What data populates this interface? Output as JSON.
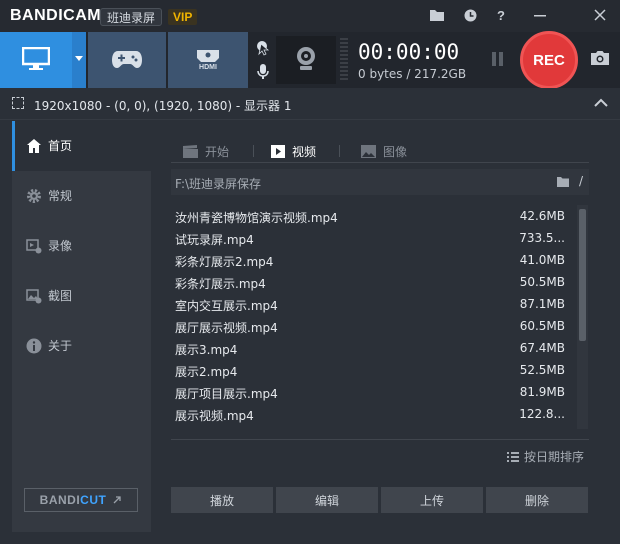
{
  "app": {
    "logo_main": "BANDI",
    "logo_cam": "CAM",
    "tag": "班迪录屏",
    "vip": "VIP"
  },
  "titlebar_icons": [
    "folder-icon",
    "clock-icon",
    "help-icon",
    "minimize-icon",
    "close-icon"
  ],
  "toolbar": {
    "hdmi_label": "HDMI",
    "timer": "00:00:00",
    "size": "0 bytes / 217.2GB",
    "rec_label": "REC"
  },
  "resolution": {
    "text": "1920x1080 - (0, 0), (1920, 1080) - 显示器 1"
  },
  "sidebar": {
    "items": [
      {
        "label": "首页",
        "icon": "home-icon",
        "active": true
      },
      {
        "label": "常规",
        "icon": "gear-icon",
        "active": false
      },
      {
        "label": "录像",
        "icon": "video-settings-icon",
        "active": false
      },
      {
        "label": "截图",
        "icon": "image-settings-icon",
        "active": false
      },
      {
        "label": "关于",
        "icon": "info-icon",
        "active": false
      }
    ],
    "bandicut_a": "BANDI",
    "bandicut_b": "CUT"
  },
  "tabs": [
    {
      "label": "开始",
      "active": false
    },
    {
      "label": "视频",
      "active": true
    },
    {
      "label": "图像",
      "active": false
    }
  ],
  "path": {
    "text": "F:\\班迪录屏保存",
    "root": "/"
  },
  "files": [
    {
      "name": "汝州青瓷博物馆演示视频.mp4",
      "size": "42.6MB"
    },
    {
      "name": "试玩录屏.mp4",
      "size": "733.5..."
    },
    {
      "name": "彩条灯展示2.mp4",
      "size": "41.0MB"
    },
    {
      "name": "彩条灯展示.mp4",
      "size": "50.5MB"
    },
    {
      "name": "室内交互展示.mp4",
      "size": "87.1MB"
    },
    {
      "name": "展厅展示视频.mp4",
      "size": "60.5MB"
    },
    {
      "name": "展示3.mp4",
      "size": "67.4MB"
    },
    {
      "name": "展示2.mp4",
      "size": "52.5MB"
    },
    {
      "name": "展厅项目展示.mp4",
      "size": "81.9MB"
    },
    {
      "name": "展示视频.mp4",
      "size": "122.8..."
    }
  ],
  "sort_label": "按日期排序",
  "actions": {
    "play": "播放",
    "edit": "编辑",
    "upload": "上传",
    "delete": "删除"
  },
  "colors": {
    "accent": "#2f8fe0",
    "rec": "#e1393a",
    "vip": "#f0b400"
  }
}
